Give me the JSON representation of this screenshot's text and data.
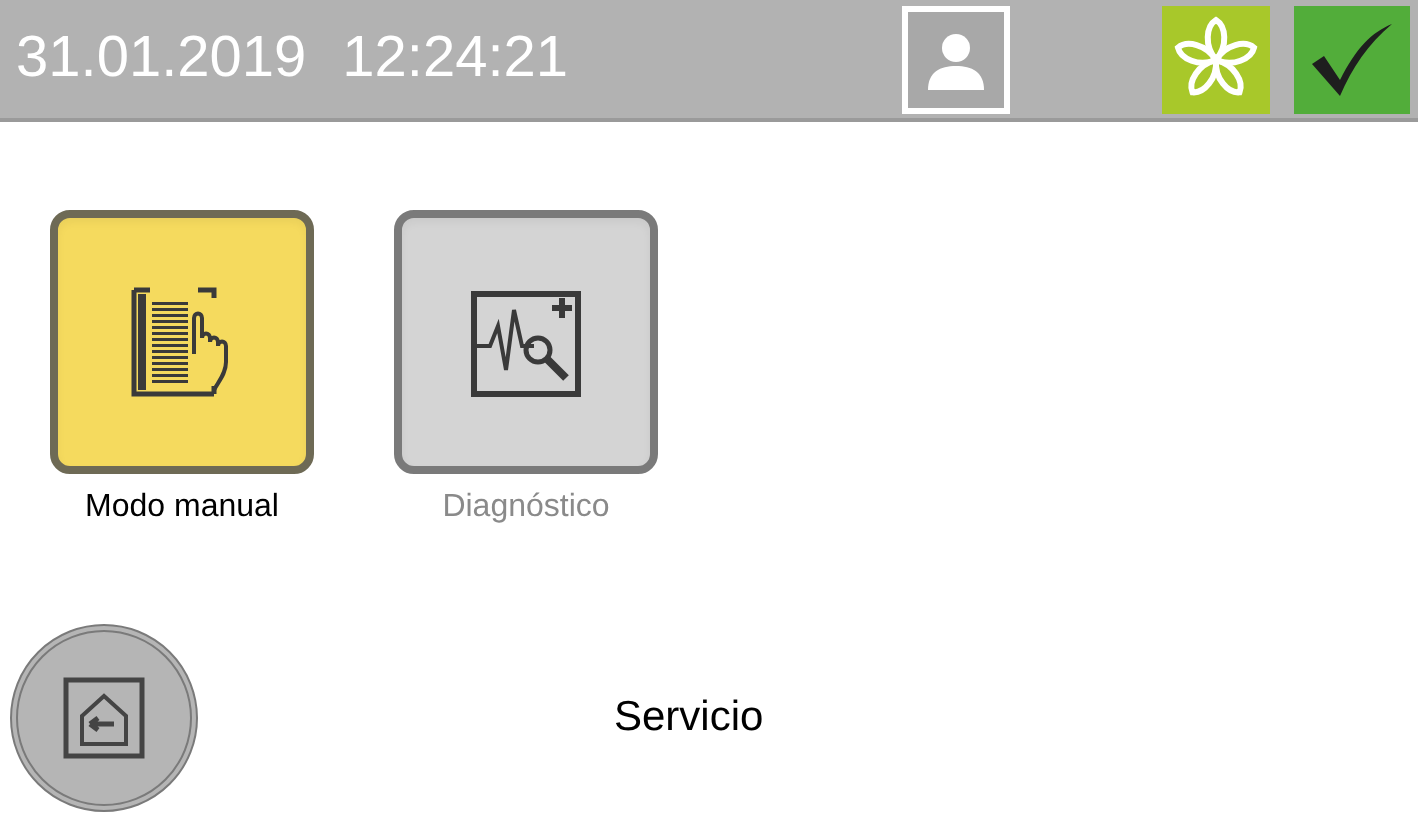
{
  "header": {
    "date": "31.01.2019",
    "time": "12:24:21"
  },
  "tiles": [
    {
      "kind": "manual",
      "label": "Modo manual",
      "disabled": false
    },
    {
      "kind": "diagnostic",
      "label": "Diagnóstico",
      "disabled": true
    }
  ],
  "footer": {
    "title": "Servicio"
  }
}
